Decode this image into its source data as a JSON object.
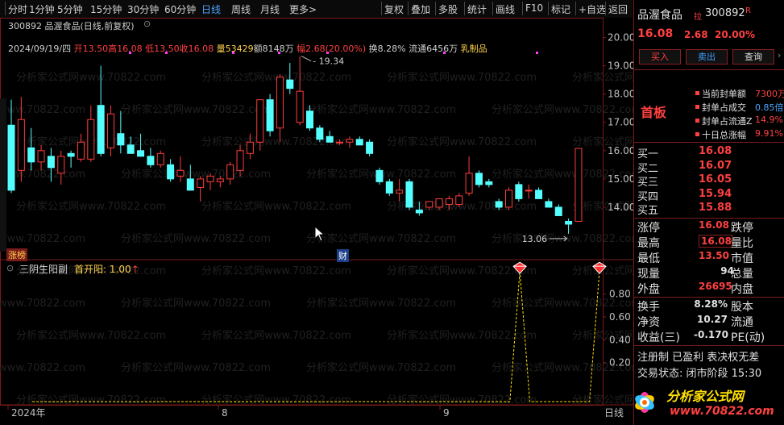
{
  "toolbar": {
    "left_items": [
      "分时",
      "1分钟",
      "5分钟",
      "15分钟",
      "30分钟",
      "60分钟",
      "日线",
      "周线",
      "月线",
      "更多>"
    ],
    "right_items": [
      "复权",
      "叠加",
      "多股",
      "统计",
      "画线",
      "F10",
      "标记",
      "+自选",
      "返回"
    ]
  },
  "chart": {
    "title": "300892 品渥食品(日线,前复权)",
    "info_date": "2024/09/19/四",
    "info_open": "开13.50",
    "info_high": "高16.08",
    "info_low": "低13.50",
    "info_close": "收16.08",
    "info_vol": "量53429",
    "info_amount": "额8148万",
    "info_change": "幅2.68(20.00%)",
    "info_turnover": "换8.28%",
    "info_float": "流通6456万",
    "info_sector": "乳制品",
    "high_label": "19.34",
    "low_label": "13.06",
    "tag_zhangting": "涨榜",
    "tag_cai": "财",
    "price_axis": [
      "20.00",
      "19.00",
      "18.00",
      "17.00",
      "16.00",
      "15.00",
      "14.00"
    ],
    "date_axis": [
      "2024年",
      "8",
      "9"
    ],
    "date_axis_right": "日线",
    "candle_colors": {
      "up": "#ff3c3c",
      "down": "#54ffff"
    }
  },
  "chart_data": {
    "type": "candlestick",
    "ylim": [
      13.0,
      20.3
    ],
    "candles": [
      {
        "o": 16.9,
        "h": 17.8,
        "l": 14.5,
        "c": 14.6
      },
      {
        "o": 15.3,
        "h": 17.9,
        "l": 14.9,
        "c": 17.1
      },
      {
        "o": 16.1,
        "h": 16.8,
        "l": 15.3,
        "c": 15.6
      },
      {
        "o": 15.6,
        "h": 16.2,
        "l": 15.3,
        "c": 16.0
      },
      {
        "o": 15.8,
        "h": 16.1,
        "l": 14.9,
        "c": 15.4
      },
      {
        "o": 15.2,
        "h": 16.0,
        "l": 14.8,
        "c": 15.8
      },
      {
        "o": 15.9,
        "h": 16.0,
        "l": 15.4,
        "c": 15.8
      },
      {
        "o": 15.7,
        "h": 16.6,
        "l": 15.6,
        "c": 16.3
      },
      {
        "o": 15.7,
        "h": 17.6,
        "l": 15.6,
        "c": 17.1
      },
      {
        "o": 17.6,
        "h": 19.0,
        "l": 15.8,
        "c": 15.9
      },
      {
        "o": 16.1,
        "h": 17.6,
        "l": 15.8,
        "c": 17.3
      },
      {
        "o": 16.6,
        "h": 17.4,
        "l": 15.9,
        "c": 16.2
      },
      {
        "o": 16.2,
        "h": 16.5,
        "l": 15.9,
        "c": 15.9
      },
      {
        "o": 16.0,
        "h": 16.6,
        "l": 15.8,
        "c": 15.8
      },
      {
        "o": 15.8,
        "h": 16.1,
        "l": 15.4,
        "c": 15.5
      },
      {
        "o": 15.5,
        "h": 16.0,
        "l": 15.4,
        "c": 15.9
      },
      {
        "o": 15.5,
        "h": 15.7,
        "l": 14.9,
        "c": 15.0
      },
      {
        "o": 15.1,
        "h": 15.8,
        "l": 14.9,
        "c": 15.3
      },
      {
        "o": 15.0,
        "h": 15.5,
        "l": 14.7,
        "c": 14.6
      },
      {
        "o": 14.7,
        "h": 15.1,
        "l": 14.2,
        "c": 15.0
      },
      {
        "o": 14.9,
        "h": 15.2,
        "l": 14.6,
        "c": 15.1
      },
      {
        "o": 14.9,
        "h": 15.1,
        "l": 14.7,
        "c": 15.0
      },
      {
        "o": 15.0,
        "h": 15.6,
        "l": 14.8,
        "c": 15.5
      },
      {
        "o": 15.3,
        "h": 16.2,
        "l": 15.1,
        "c": 16.0
      },
      {
        "o": 15.9,
        "h": 16.6,
        "l": 15.7,
        "c": 16.3
      },
      {
        "o": 16.3,
        "h": 17.6,
        "l": 16.0,
        "c": 17.8
      },
      {
        "o": 17.8,
        "h": 18.0,
        "l": 16.5,
        "c": 16.7
      },
      {
        "o": 16.8,
        "h": 18.7,
        "l": 16.3,
        "c": 18.6
      },
      {
        "o": 18.5,
        "h": 19.1,
        "l": 18.0,
        "c": 18.2
      },
      {
        "o": 17.0,
        "h": 19.34,
        "l": 16.9,
        "c": 18.1
      },
      {
        "o": 17.4,
        "h": 17.6,
        "l": 16.7,
        "c": 16.8
      },
      {
        "o": 16.8,
        "h": 16.9,
        "l": 16.3,
        "c": 16.4
      },
      {
        "o": 16.5,
        "h": 16.7,
        "l": 16.3,
        "c": 16.3
      },
      {
        "o": 16.3,
        "h": 16.4,
        "l": 16.2,
        "c": 16.3
      },
      {
        "o": 16.3,
        "h": 16.5,
        "l": 16.1,
        "c": 16.4
      },
      {
        "o": 16.4,
        "h": 16.5,
        "l": 16.3,
        "c": 16.2
      },
      {
        "o": 16.3,
        "h": 16.4,
        "l": 15.8,
        "c": 15.9
      },
      {
        "o": 15.3,
        "h": 15.4,
        "l": 14.8,
        "c": 14.9
      },
      {
        "o": 14.9,
        "h": 15.0,
        "l": 14.4,
        "c": 14.5
      },
      {
        "o": 14.5,
        "h": 15.0,
        "l": 14.2,
        "c": 14.6
      },
      {
        "o": 14.9,
        "h": 15.0,
        "l": 13.9,
        "c": 14.0
      },
      {
        "o": 13.9,
        "h": 14.2,
        "l": 13.7,
        "c": 13.8
      },
      {
        "o": 14.0,
        "h": 14.2,
        "l": 13.9,
        "c": 14.2
      },
      {
        "o": 14.0,
        "h": 14.3,
        "l": 13.9,
        "c": 14.3
      },
      {
        "o": 14.1,
        "h": 14.4,
        "l": 13.9,
        "c": 14.3
      },
      {
        "o": 14.1,
        "h": 14.5,
        "l": 14.0,
        "c": 14.4
      },
      {
        "o": 14.5,
        "h": 15.8,
        "l": 14.4,
        "c": 15.2
      },
      {
        "o": 15.2,
        "h": 15.3,
        "l": 14.7,
        "c": 14.8
      },
      {
        "o": 14.9,
        "h": 15.0,
        "l": 14.7,
        "c": 14.8
      },
      {
        "o": 14.2,
        "h": 14.3,
        "l": 13.9,
        "c": 14.0
      },
      {
        "o": 14.0,
        "h": 14.7,
        "l": 13.9,
        "c": 14.6
      },
      {
        "o": 14.8,
        "h": 14.9,
        "l": 14.2,
        "c": 14.3
      },
      {
        "o": 14.6,
        "h": 14.8,
        "l": 14.3,
        "c": 14.6
      },
      {
        "o": 14.6,
        "h": 14.7,
        "l": 14.3,
        "c": 14.3
      },
      {
        "o": 14.2,
        "h": 14.3,
        "l": 14.0,
        "c": 14.0
      },
      {
        "o": 14.0,
        "h": 14.1,
        "l": 13.7,
        "c": 13.7
      },
      {
        "o": 13.5,
        "h": 13.6,
        "l": 13.06,
        "c": 13.4
      },
      {
        "o": 13.5,
        "h": 16.08,
        "l": 13.5,
        "c": 16.08
      }
    ],
    "indicator": {
      "name": "三阴生阳副",
      "series_name": "首开阳",
      "series_value": "1.00",
      "ylim": [
        0,
        1.1
      ],
      "y_ticks": [
        "0.80",
        "0.60",
        "0.40",
        "0.20"
      ],
      "signal_indices": [
        49,
        57
      ]
    }
  },
  "quote": {
    "name": "品渥食品",
    "badge": "拉",
    "code": "300892",
    "r_badge": "R",
    "price": "16.08",
    "change": "2.68",
    "pct": "20.00%",
    "buttons": [
      "买入",
      "卖出",
      "查询"
    ],
    "board_label": "首板",
    "seal_items": [
      {
        "label": "当前封单额",
        "value": "7300万"
      },
      {
        "label": "封单占成交",
        "value": "0.85倍"
      },
      {
        "label": "封单占流通Z",
        "value": "14.9%"
      },
      {
        "label": "十日总涨幅",
        "value": "9.91%"
      }
    ],
    "bids": [
      {
        "label": "买一",
        "price": "16.08"
      },
      {
        "label": "买二",
        "price": "16.07"
      },
      {
        "label": "买三",
        "price": "16.05"
      },
      {
        "label": "买四",
        "price": "15.94"
      },
      {
        "label": "买五",
        "price": "15.88"
      }
    ],
    "stats": [
      {
        "l1": "涨停",
        "v1": "16.08",
        "l2": "跌停"
      },
      {
        "l1": "最高",
        "v1": "16.08",
        "l2": "量比"
      },
      {
        "l1": "最低",
        "v1": "13.50",
        "l2": "市值"
      },
      {
        "l1": "现量",
        "v1": "94",
        "l2": "总量"
      },
      {
        "l1": "外盘",
        "v1": "26695",
        "l2": "内盘"
      }
    ],
    "stats2": [
      {
        "l1": "换手",
        "v1": "8.28%",
        "l2": "股本"
      },
      {
        "l1": "净资",
        "v1": "10.27",
        "l2": "流通"
      },
      {
        "l1": "收益(三)",
        "v1": "-0.170",
        "l2": "PE(动)"
      }
    ],
    "reg_line": "注册制 已盈利 表决权无差",
    "trade_status": "交易状态: 闭市阶段 15:30",
    "logo_text": "分析家公式网",
    "logo_url": "www.70822.com"
  },
  "watermark": "分析家公式网www.70822.com"
}
